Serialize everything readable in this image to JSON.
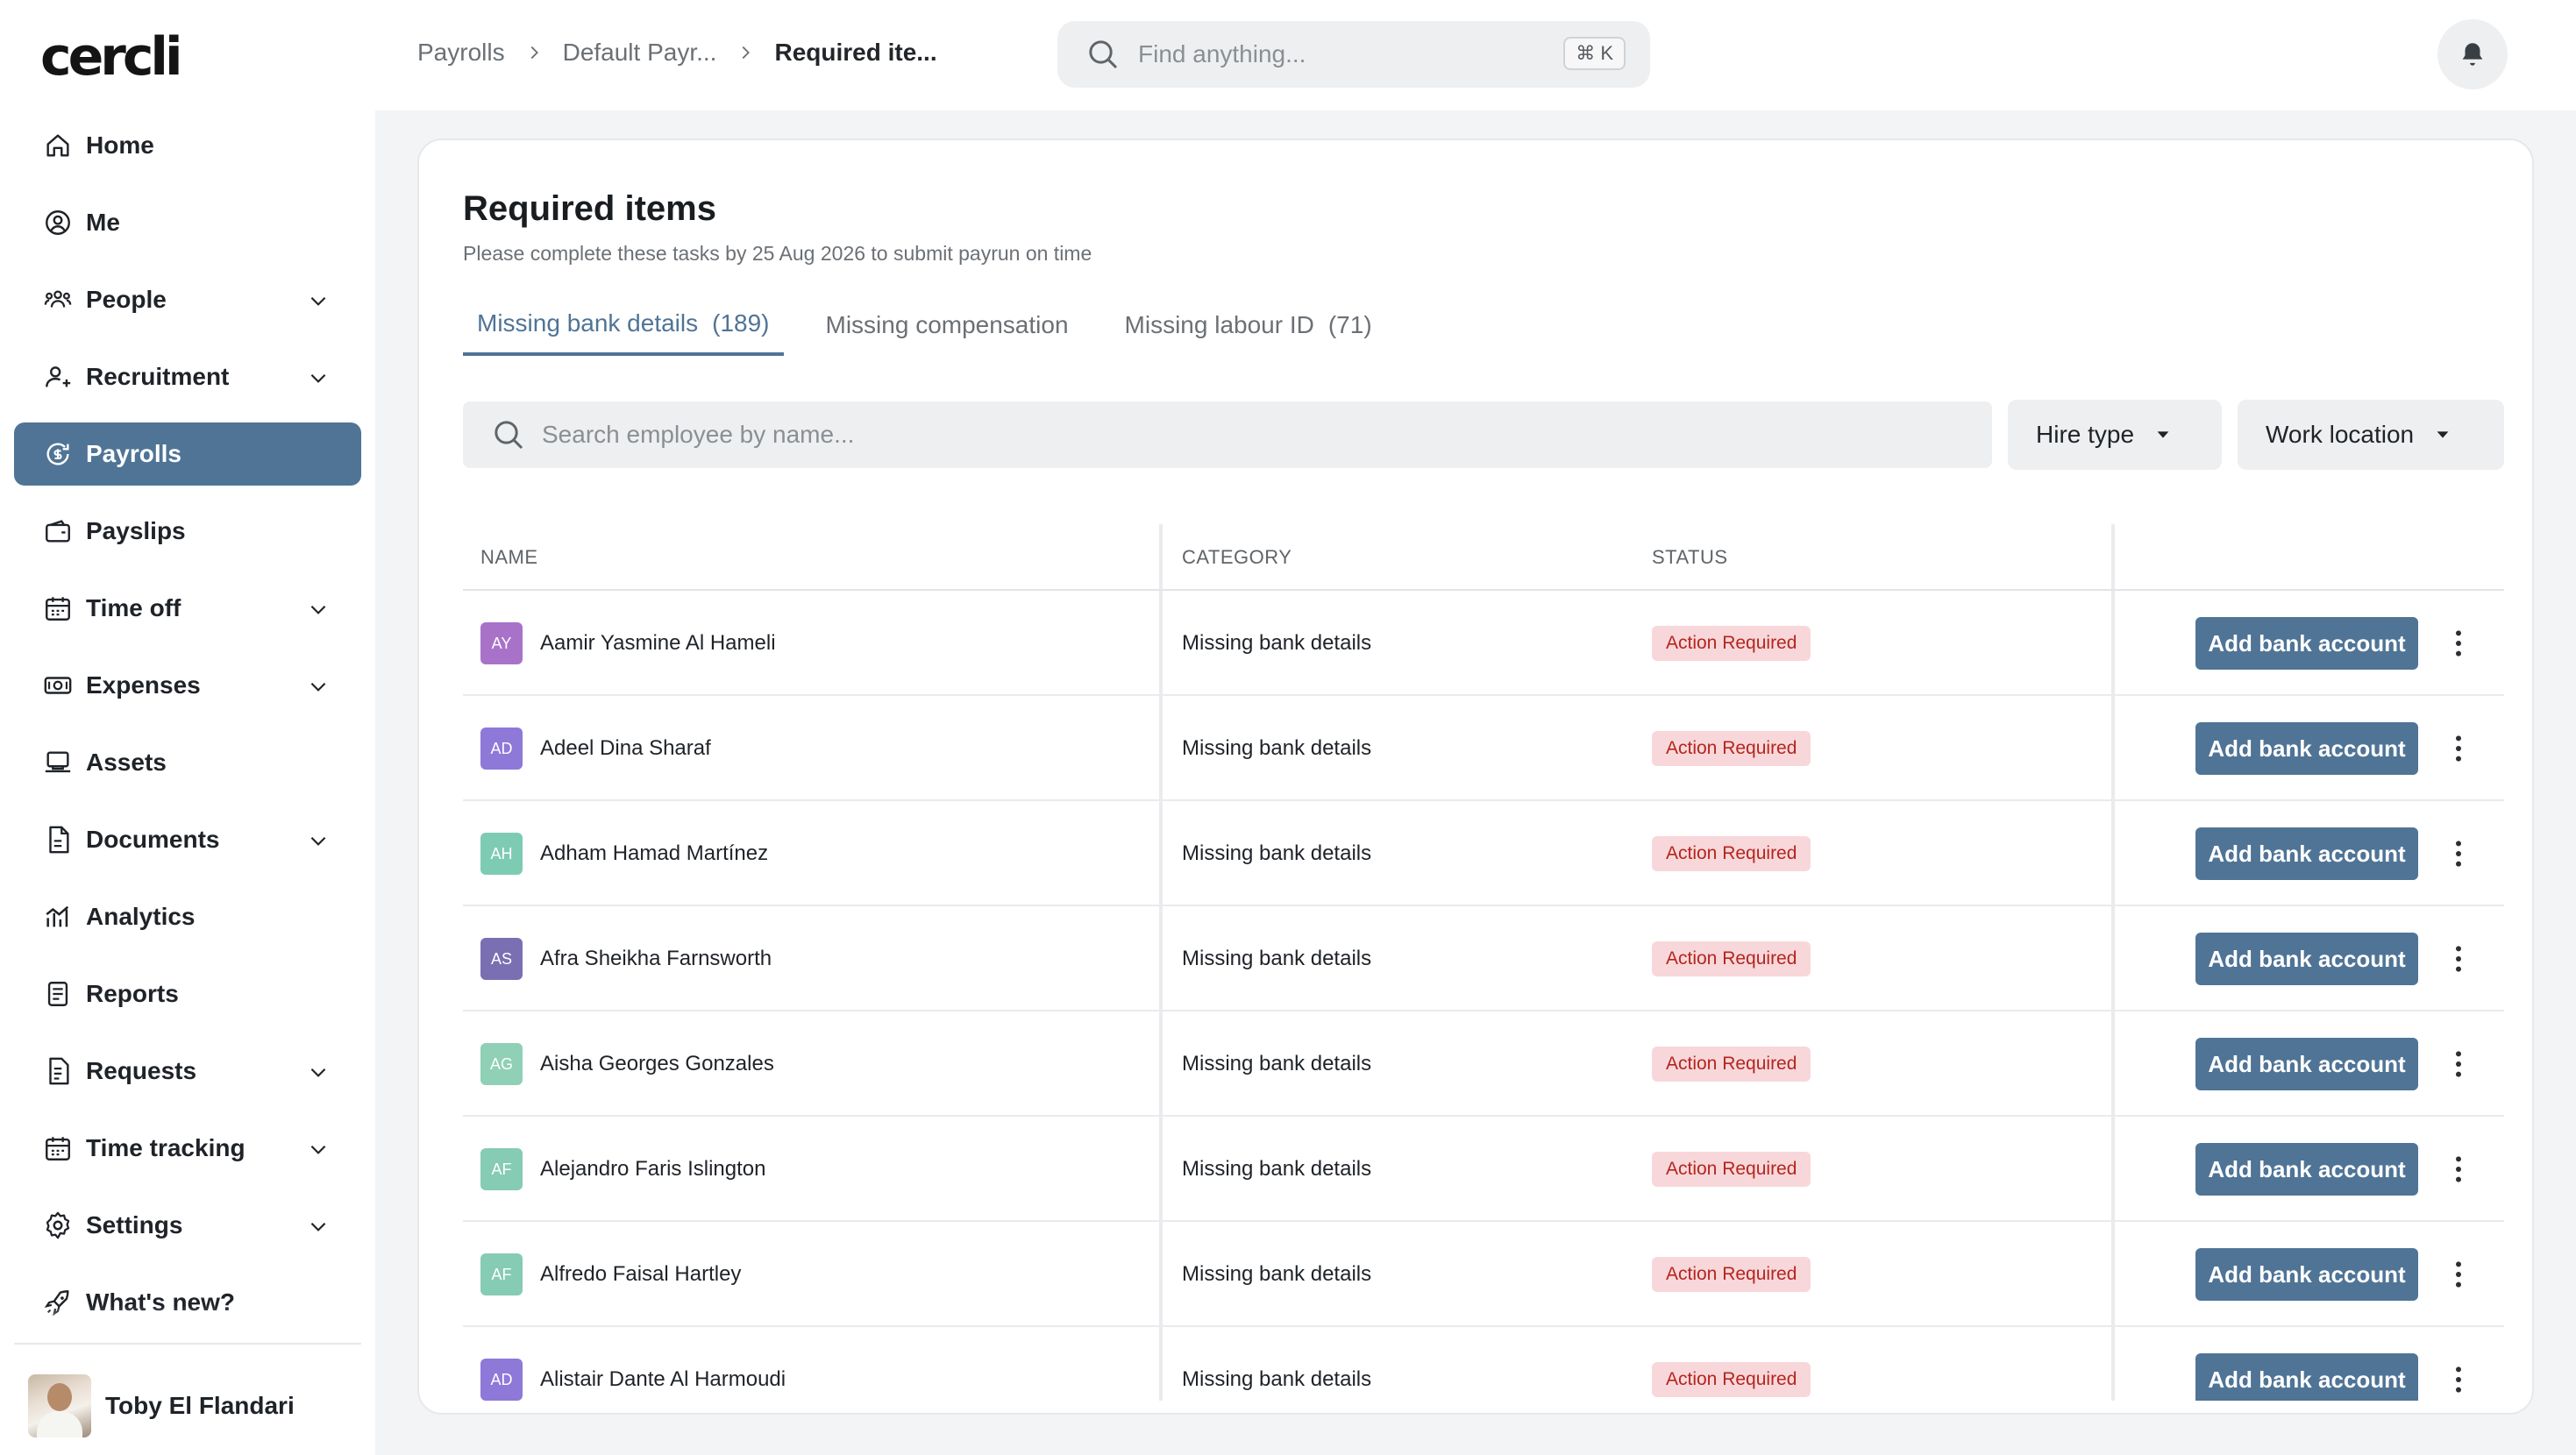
{
  "app": {
    "logo_text": "cercli"
  },
  "sidebar": {
    "items": [
      {
        "label": "Home",
        "icon": "home-icon",
        "has_chevron": false,
        "active": false
      },
      {
        "label": "Me",
        "icon": "user-circle-icon",
        "has_chevron": false,
        "active": false
      },
      {
        "label": "People",
        "icon": "people-icon",
        "has_chevron": true,
        "active": false
      },
      {
        "label": "Recruitment",
        "icon": "recruit-icon",
        "has_chevron": true,
        "active": false
      },
      {
        "label": "Payrolls",
        "icon": "payroll-icon",
        "has_chevron": false,
        "active": true
      },
      {
        "label": "Payslips",
        "icon": "wallet-icon",
        "has_chevron": false,
        "active": false
      },
      {
        "label": "Time off",
        "icon": "calendar-icon",
        "has_chevron": true,
        "active": false
      },
      {
        "label": "Expenses",
        "icon": "money-icon",
        "has_chevron": true,
        "active": false
      },
      {
        "label": "Assets",
        "icon": "laptop-icon",
        "has_chevron": false,
        "active": false
      },
      {
        "label": "Documents",
        "icon": "document-icon",
        "has_chevron": true,
        "active": false
      },
      {
        "label": "Analytics",
        "icon": "analytics-icon",
        "has_chevron": false,
        "active": false
      },
      {
        "label": "Reports",
        "icon": "report-icon",
        "has_chevron": false,
        "active": false
      },
      {
        "label": "Requests",
        "icon": "request-icon",
        "has_chevron": true,
        "active": false
      },
      {
        "label": "Time tracking",
        "icon": "calendar-icon",
        "has_chevron": true,
        "active": false
      },
      {
        "label": "Settings",
        "icon": "gear-icon",
        "has_chevron": true,
        "active": false
      },
      {
        "label": "What's new?",
        "icon": "rocket-icon",
        "has_chevron": false,
        "active": false
      }
    ],
    "user": {
      "name": "Toby El Flandari"
    }
  },
  "topbar": {
    "breadcrumb": [
      "Payrolls",
      "Default Payr...",
      "Required ite..."
    ],
    "search_placeholder": "Find anything...",
    "shortcut": "⌘ K"
  },
  "page": {
    "title": "Required items",
    "subtitle": "Please complete these tasks by 25 Aug 2026 to submit payrun on time",
    "tabs": [
      {
        "label": "Missing bank details",
        "count": "(189)",
        "active": true
      },
      {
        "label": "Missing compensation",
        "count": "",
        "active": false
      },
      {
        "label": "Missing labour ID",
        "count": "(71)",
        "active": false
      }
    ],
    "search_placeholder": "Search employee by name...",
    "filters": {
      "hire_type": "Hire type",
      "work_location": "Work location"
    }
  },
  "table": {
    "columns": [
      "NAME",
      "CATEGORY",
      "STATUS"
    ],
    "action_label": "Add bank account",
    "rows": [
      {
        "initials": "AY",
        "color": "#a872c9",
        "name": "Aamir Yasmine Al Hameli",
        "category": "Missing bank details",
        "status": "Action Required"
      },
      {
        "initials": "AD",
        "color": "#8e78d8",
        "name": "Adeel Dina Sharaf",
        "category": "Missing bank details",
        "status": "Action Required"
      },
      {
        "initials": "AH",
        "color": "#7ecbb3",
        "name": "Adham Hamad Martínez",
        "category": "Missing bank details",
        "status": "Action Required"
      },
      {
        "initials": "AS",
        "color": "#7a6fb3",
        "name": "Afra Sheikha Farnsworth",
        "category": "Missing bank details",
        "status": "Action Required"
      },
      {
        "initials": "AG",
        "color": "#8fd0b6",
        "name": "Aisha Georges Gonzales",
        "category": "Missing bank details",
        "status": "Action Required"
      },
      {
        "initials": "AF",
        "color": "#86cbb4",
        "name": "Alejandro Faris Islington",
        "category": "Missing bank details",
        "status": "Action Required"
      },
      {
        "initials": "AF",
        "color": "#86cbb4",
        "name": "Alfredo Faisal Hartley",
        "category": "Missing bank details",
        "status": "Action Required"
      },
      {
        "initials": "AD",
        "color": "#8e78d8",
        "name": "Alistair Dante Al Harmoudi",
        "category": "Missing bank details",
        "status": "Action Required"
      }
    ]
  },
  "colors": {
    "accent": "#4f7496",
    "badge_bg": "#f8d7da",
    "badge_text": "#b3261e"
  }
}
